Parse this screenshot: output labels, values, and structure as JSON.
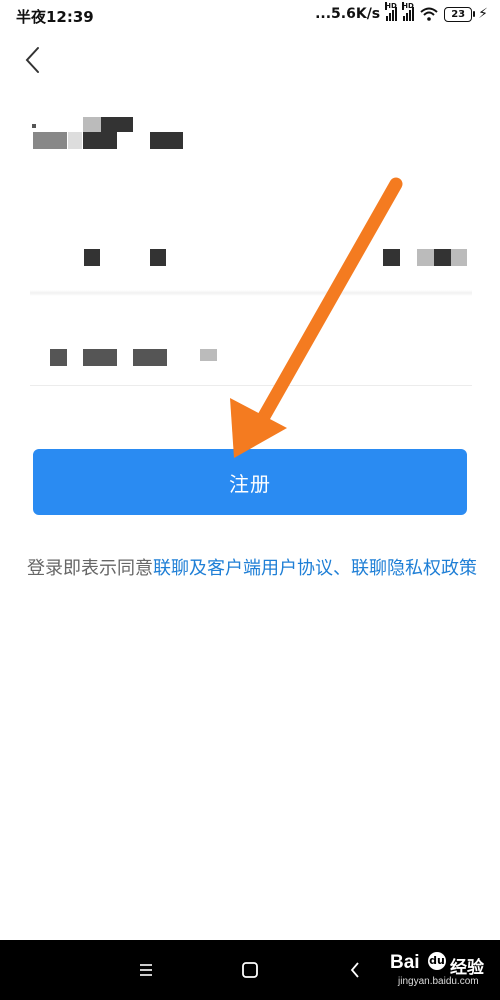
{
  "status_bar": {
    "time": "半夜12:39",
    "network_speed": "...5.6K/s",
    "signal_badge": "HD",
    "battery": "23"
  },
  "form": {
    "register_label": "注册"
  },
  "agreement": {
    "prefix": "登录即表示同意",
    "link_user_agreement": "联聊及客户端用户协议",
    "separator": "、",
    "link_privacy_policy": "联聊隐私权政策"
  },
  "watermark": {
    "brand": "Bai",
    "paw": "du",
    "cn": "经验",
    "url": "jingyan.baidu.com"
  },
  "colors": {
    "primary": "#2a8bf2",
    "link": "#1f7fd6",
    "arrow": "#f47b20"
  },
  "icons": {
    "back": "chevron-left-icon",
    "menu": "hamburger-icon",
    "home": "square-icon",
    "nav_back": "chevron-left-icon"
  }
}
